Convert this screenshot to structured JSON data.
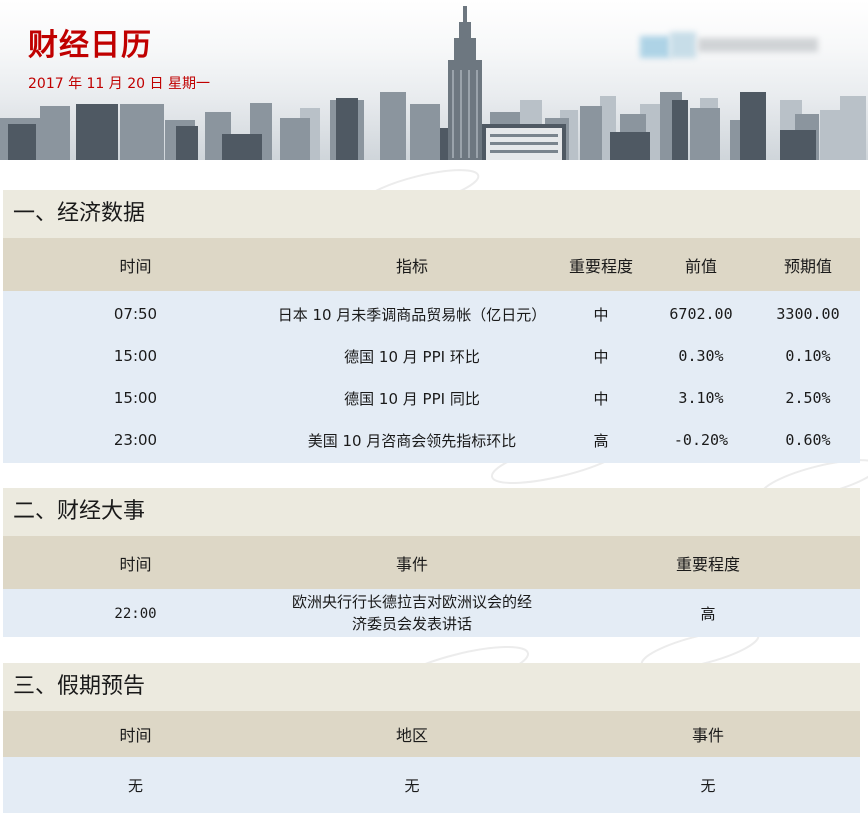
{
  "header": {
    "title": "财经日历",
    "date": "2017 年 11 月 20 日  星期一"
  },
  "section1": {
    "title": "一、经济数据",
    "columns": [
      "时间",
      "指标",
      "重要程度",
      "前值",
      "预期值"
    ],
    "rows": [
      {
        "time": "07:50",
        "indicator": "日本 10 月未季调商品贸易帐（亿日元）",
        "importance": "中",
        "previous": "6702.00",
        "forecast": "3300.00"
      },
      {
        "time": "15:00",
        "indicator": "德国 10 月 PPI 环比",
        "importance": "中",
        "previous": "0.30%",
        "forecast": "0.10%"
      },
      {
        "time": "15:00",
        "indicator": "德国 10 月 PPI 同比",
        "importance": "中",
        "previous": "3.10%",
        "forecast": "2.50%"
      },
      {
        "time": "23:00",
        "indicator": "美国 10 月咨商会领先指标环比",
        "importance": "高",
        "previous": "-0.20%",
        "forecast": "0.60%"
      }
    ]
  },
  "section2": {
    "title": "二、财经大事",
    "columns": [
      "时间",
      "事件",
      "重要程度"
    ],
    "rows": [
      {
        "time": "22:00",
        "event_line1": "欧洲央行行长德拉吉对欧洲议会的经",
        "event_line2": "济委员会发表讲话",
        "importance": "高"
      }
    ]
  },
  "section3": {
    "title": "三、假期预告",
    "columns": [
      "时间",
      "地区",
      "事件"
    ],
    "rows": [
      {
        "time": "无",
        "region": "无",
        "event": "无"
      }
    ]
  },
  "colors": {
    "title_red": "#c00000",
    "section_title_bg": "#eceadf",
    "table_header_bg": "#ddd7c6",
    "table_body_bg": "#e4ecf5"
  }
}
